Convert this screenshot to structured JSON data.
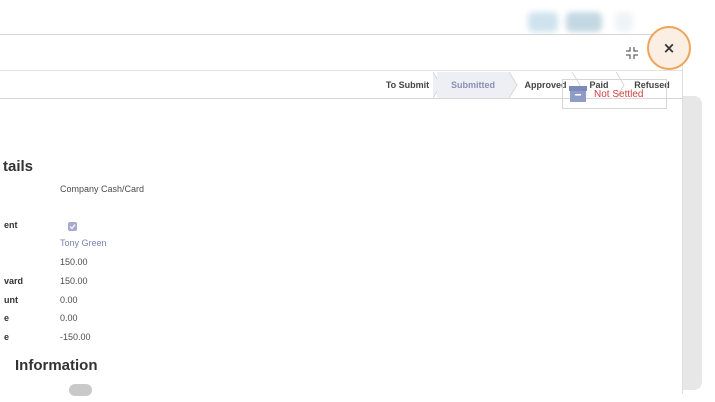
{
  "dialog": {
    "restore_icon": "restore-icon",
    "close_icon": "close-icon",
    "close_glyph": "×"
  },
  "statusbar": {
    "stages": [
      "To Submit",
      "Submitted",
      "Approved",
      "Paid",
      "Refused"
    ],
    "active_stage": "Submitted"
  },
  "badge": {
    "icon": "archive-icon",
    "text": "Not Settled",
    "color": "#d23f3f"
  },
  "details": {
    "title": "tails",
    "fields": [
      {
        "label": "",
        "value": "Company Cash/Card"
      },
      {
        "label": "ent",
        "value": "checked"
      },
      {
        "label": "",
        "value": "Tony Green"
      },
      {
        "label": "",
        "value": "150.00"
      },
      {
        "label": "vard",
        "value": "150.00"
      },
      {
        "label": "unt",
        "value": "0.00"
      },
      {
        "label": "e",
        "value": "0.00"
      },
      {
        "label": "e",
        "value": "-150.00"
      }
    ]
  },
  "information": {
    "title": "Information"
  },
  "colors": {
    "accent": "#7c7fb1",
    "highlight_ring": "#f0a35a",
    "active_stage_bg": "#eeeef5"
  }
}
